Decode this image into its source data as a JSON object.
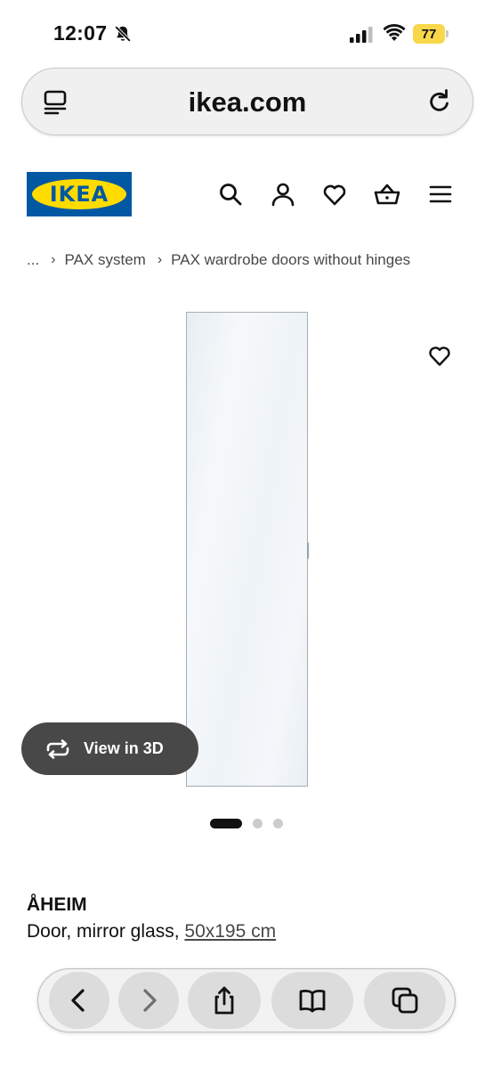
{
  "status_bar": {
    "time": "12:07",
    "battery": "77"
  },
  "browser": {
    "url": "ikea.com"
  },
  "header": {
    "logo_text": "IKEA"
  },
  "breadcrumb": {
    "ellipsis": "...",
    "items": [
      "PAX system",
      "PAX wardrobe doors without hinges"
    ]
  },
  "gallery": {
    "view_3d_label": "View in 3D",
    "total_images": 3,
    "active_index": 0
  },
  "product": {
    "name": "ÅHEIM",
    "description": "Door, mirror glass,",
    "size": "50x195 cm"
  },
  "colors": {
    "ikea_blue": "#0058a3",
    "ikea_yellow": "#ffdb00",
    "battery_yellow": "#f8d84a",
    "dark_button": "#484848"
  },
  "icons": [
    "bell-slash-icon",
    "signal-icon",
    "wifi-icon",
    "reader-icon",
    "reload-icon",
    "search-icon",
    "user-icon",
    "heart-icon",
    "basket-icon",
    "menu-icon",
    "rotate-3d-icon",
    "back-icon",
    "forward-icon",
    "share-icon",
    "bookmarks-icon",
    "tabs-icon"
  ]
}
